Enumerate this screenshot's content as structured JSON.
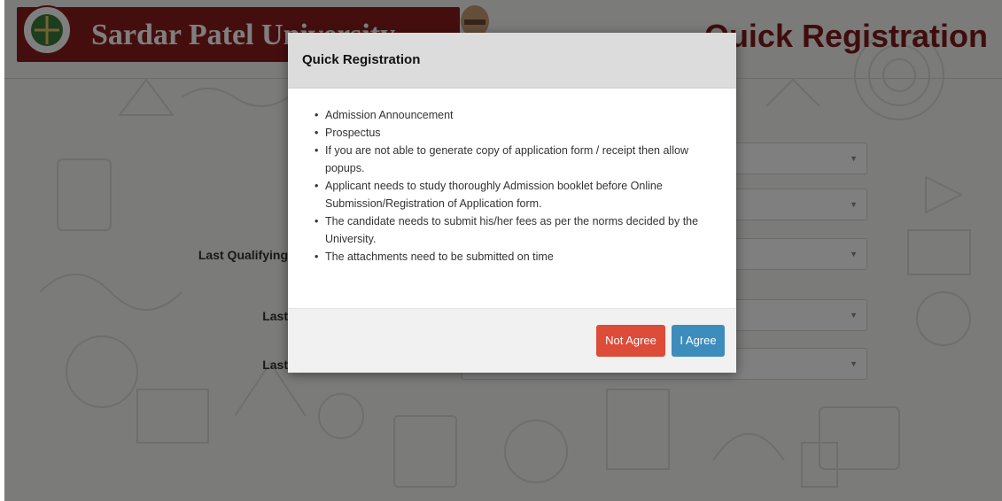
{
  "header": {
    "university_name": "Sardar Patel University",
    "page_title": "Quick Registration",
    "logo_icon": "university-emblem-icon",
    "portrait_icon": "sardar-patel-portrait-icon"
  },
  "form": {
    "fields": [
      {
        "label": ""
      },
      {
        "label": ""
      },
      {
        "label": "Last Qualifying"
      },
      {
        "label": "Last"
      },
      {
        "label": "Last"
      }
    ]
  },
  "modal": {
    "title": "Quick Registration",
    "items": [
      "Admission Announcement",
      "Prospectus",
      "If you are not able to generate copy of application form / receipt then allow popups.",
      "Applicant needs to study thoroughly Admission booklet before Online Submission/Registration of Application form.",
      "The candidate needs to submit his/her fees as per the norms decided by the University.",
      "The attachments need to be submitted on time"
    ],
    "buttons": {
      "not_agree": "Not Agree",
      "agree": "I Agree"
    }
  },
  "colors": {
    "brand": "#8b1c1c",
    "title": "#7e1b1b",
    "danger": "#dd4b39",
    "primary": "#3c8dbc"
  }
}
